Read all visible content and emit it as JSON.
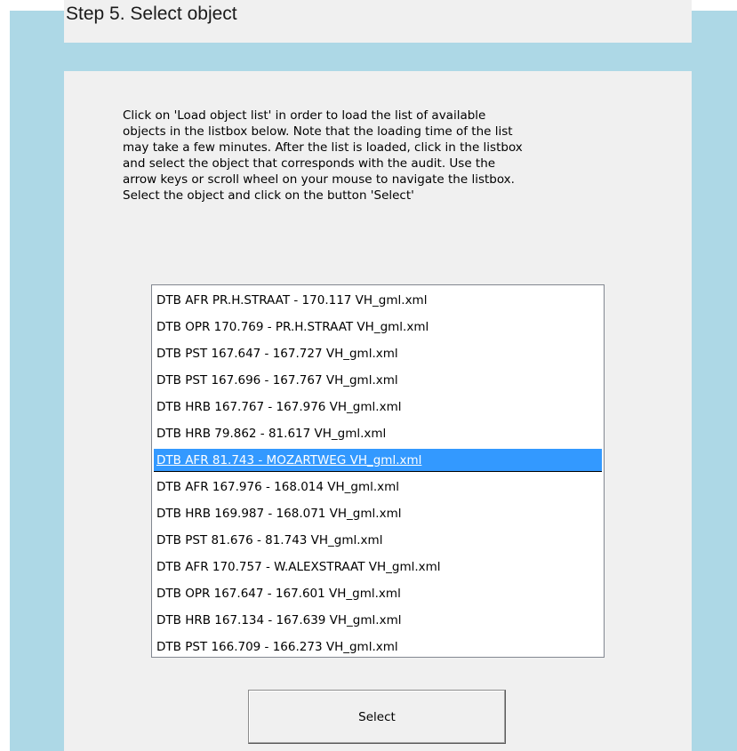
{
  "header": {
    "title": "Step 5. Select object"
  },
  "instructions": "Click on 'Load object list' in order to load the list of available\nobjects in the listbox below. Note that the loading time of the list\nmay take a few minutes. After the list is loaded, click in the listbox\nand select the object that corresponds with the audit. Use the\narrow keys or scroll wheel on your mouse to navigate the listbox.\nSelect the object and click on the button 'Select'",
  "object_list": {
    "selected_index": 6,
    "items": [
      "DTB AFR PR.H.STRAAT - 170.117 VH_gml.xml",
      "DTB OPR 170.769 - PR.H.STRAAT VH_gml.xml",
      "DTB PST 167.647 - 167.727 VH_gml.xml",
      "DTB PST 167.696 - 167.767 VH_gml.xml",
      "DTB HRB 167.767 - 167.976 VH_gml.xml",
      "DTB HRB 79.862 - 81.617 VH_gml.xml",
      "DTB AFR 81.743 - MOZARTWEG VH_gml.xml",
      "DTB AFR 167.976 - 168.014 VH_gml.xml",
      "DTB HRB 169.987 - 168.071 VH_gml.xml",
      "DTB PST 81.676 - 81.743 VH_gml.xml",
      "DTB AFR 170.757 - W.ALEXSTRAAT VH_gml.xml",
      "DTB OPR 167.647 - 167.601 VH_gml.xml",
      "DTB HRB 167.134 - 167.639 VH_gml.xml",
      "DTB PST 166.709 - 166.273 VH_gml.xml"
    ]
  },
  "buttons": {
    "select_label": "Select"
  },
  "colors": {
    "background_blue": "#add8e6",
    "panel_gray": "#f0f0f0",
    "selection_blue": "#3399ff"
  }
}
